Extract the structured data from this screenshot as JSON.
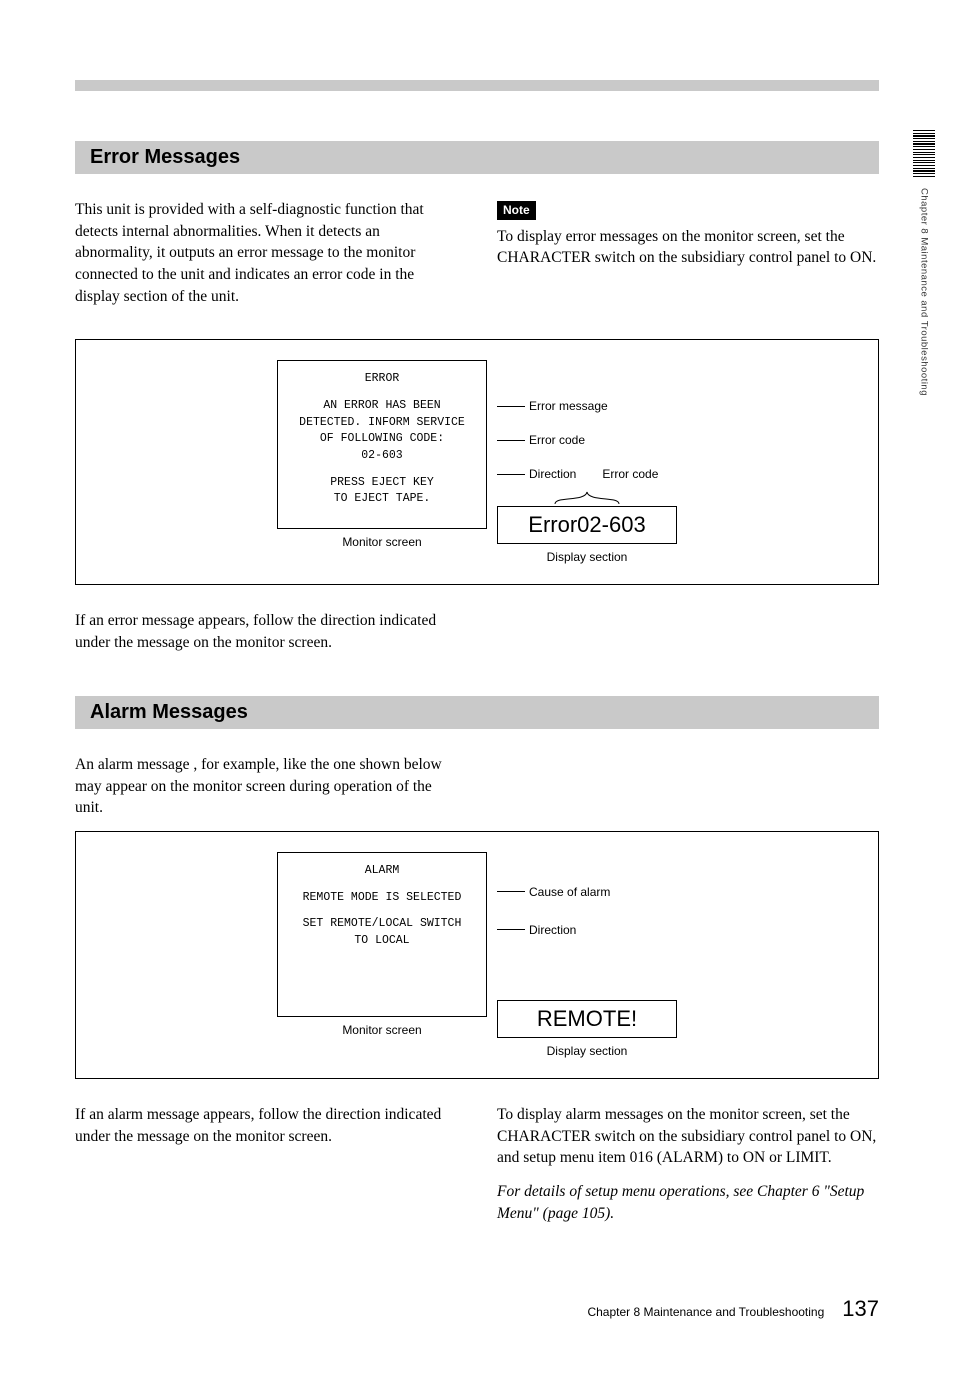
{
  "side_tab": "Chapter 8  Maintenance and Troubleshooting",
  "section1": {
    "heading": "Error Messages",
    "left": "This unit is provided with a self-diagnostic function that detects internal abnormalities.  When it detects an abnormality, it outputs an error message to the monitor connected to the unit and indicates an error code in the display section of the unit.",
    "note_label": "Note",
    "right": "To display error messages on the monitor screen, set the CHARACTER switch on the subsidiary control panel to ON.",
    "figure": {
      "monitor": {
        "title": "ERROR",
        "msg1": "AN ERROR HAS BEEN",
        "msg2": "DETECTED. INFORM SERVICE",
        "msg3": "OF FOLLOWING CODE:",
        "code": "02-603",
        "dir1": "PRESS EJECT KEY",
        "dir2": "TO EJECT TAPE.",
        "caption": "Monitor screen"
      },
      "annot": {
        "error_message": "Error message",
        "error_code": "Error code",
        "direction": "Direction",
        "error_code2": "Error code"
      },
      "display": {
        "value": "Error02-603",
        "caption": "Display section"
      }
    },
    "after": "If an error message appears, follow the direction indicated under the message on the monitor screen."
  },
  "section2": {
    "heading": "Alarm Messages",
    "intro": "An alarm message , for example, like the one shown below may appear on the monitor screen during operation of the unit.",
    "figure": {
      "monitor": {
        "title": "ALARM",
        "cause": "REMOTE MODE IS SELECTED",
        "dir1": "SET REMOTE/LOCAL SWITCH",
        "dir2": "TO LOCAL",
        "caption": "Monitor screen"
      },
      "annot": {
        "cause": "Cause of alarm",
        "direction": "Direction"
      },
      "display": {
        "value": "REMOTE!",
        "caption": "Display section"
      }
    },
    "after_left": "If an alarm message appears, follow the direction indicated under the message on the monitor screen.",
    "after_right": "To display alarm messages on the monitor screen, set the CHARACTER switch on the subsidiary control panel to ON, and setup menu item 016 (ALARM) to ON or LIMIT.",
    "after_ref": "For details of setup menu operations, see Chapter 6 \"Setup Menu\" (page 105)."
  },
  "footer": {
    "chapter": "Chapter 8   Maintenance and Troubleshooting",
    "page": "137"
  }
}
